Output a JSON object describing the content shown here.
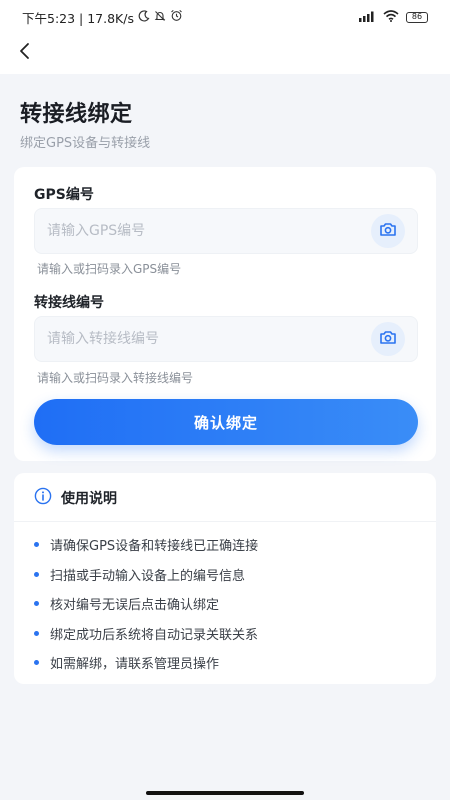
{
  "status_bar": {
    "left_text": "下午5:23 | 17.8K/s",
    "battery": "86"
  },
  "header": {
    "title": "转接线绑定",
    "subtitle": "绑定GPS设备与转接线"
  },
  "form": {
    "gps": {
      "label": "GPS编号",
      "placeholder": "请输入GPS编号",
      "value": "",
      "hint": "请输入或扫码录入GPS编号"
    },
    "adapter": {
      "label": "转接线编号",
      "placeholder": "请输入转接线编号",
      "value": "",
      "hint": "请输入或扫码录入转接线编号"
    },
    "confirm_label": "确认绑定"
  },
  "instructions": {
    "title": "使用说明",
    "items": [
      "请确保GPS设备和转接线已正确连接",
      "扫描或手动输入设备上的编号信息",
      "核对编号无误后点击确认绑定",
      "绑定成功后系统将自动记录关联关系",
      "如需解绑，请联系管理员操作"
    ]
  },
  "colors": {
    "accent": "#2a73f0",
    "background": "#f3f5f9"
  },
  "icons": {
    "back": "chevron-left-icon",
    "scan": "camera-icon",
    "info": "info-circle-icon"
  }
}
